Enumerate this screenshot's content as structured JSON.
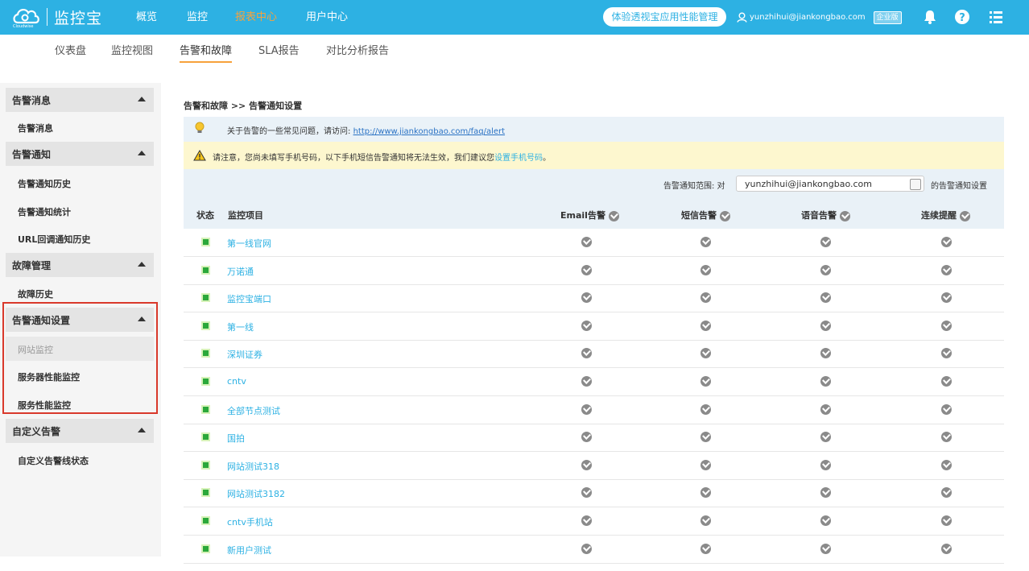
{
  "app": {
    "logo_text": "监控宝",
    "logo_sub": "Cloudwise"
  },
  "topnav": [
    {
      "label": "概览"
    },
    {
      "label": "监控"
    },
    {
      "label": "报表中心"
    },
    {
      "label": "用户中心"
    }
  ],
  "promo_button": "体验透视宝应用性能管理",
  "user": {
    "email": "yunzhihui@jiankongbao.com",
    "edition": "企业版"
  },
  "subnav": [
    "仪表盘",
    "监控视图",
    "告警和故障",
    "SLA报告",
    "对比分析报告"
  ],
  "sidebar": {
    "groups": [
      {
        "label": "告警消息",
        "items": [
          "告警消息"
        ]
      },
      {
        "label": "告警通知",
        "items": [
          "告警通知历史",
          "告警通知统计",
          "URL回调通知历史"
        ]
      },
      {
        "label": "故障管理",
        "items": [
          "故障历史"
        ]
      },
      {
        "label": "告警通知设置",
        "items": [
          "网站监控",
          "服务器性能监控",
          "服务性能监控"
        ]
      },
      {
        "label": "自定义告警",
        "items": [
          "自定义告警线状态"
        ]
      }
    ]
  },
  "breadcrumb": "告警和故障 >> 告警通知设置",
  "info": {
    "text": "关于告警的一些常见问题，请访问:",
    "link": "http://www.jiankongbao.com/faq/alert"
  },
  "warning": {
    "text": "请注意，您尚未填写手机号码，以下手机短信告警通知将无法生效，我们建议您",
    "link": "设置手机号码",
    "suffix": "。"
  },
  "scope": {
    "label": "告警通知范围: 对",
    "value": "yunzhihui@jiankongbao.com",
    "suffix": "的告警通知设置"
  },
  "table": {
    "headers": [
      "状态",
      "监控项目",
      "Email告警",
      "短信告警",
      "语音告警",
      "连续提醒"
    ],
    "rows": [
      "第一线官网",
      "万诺通",
      "监控宝端口",
      "第一线",
      "深圳证券",
      "cntv",
      "全部节点测试",
      "国拍",
      "网站测试318",
      "网站测试3182",
      "cntv手机站",
      "新用户测试"
    ]
  },
  "colors": {
    "brand": "#2db1e3",
    "active_tab": "#f7a23c",
    "status_ok": "#2ba83a",
    "highlight_box": "#d9392b"
  }
}
